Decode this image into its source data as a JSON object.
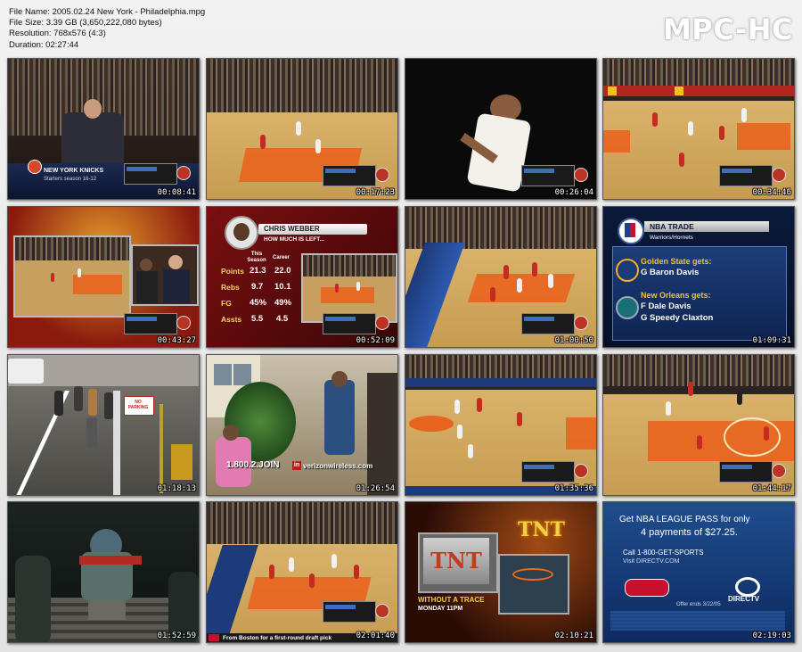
{
  "file_info": {
    "name": "File Name: 2005.02.24 New York - Philadelphia.mpg",
    "size": "File Size: 3.39 GB (3,650,222,080 bytes)",
    "resolution": "Resolution: 768x576 (4:3)",
    "duration": "Duration: 02:27:44"
  },
  "brand": "MPC-HC",
  "thumbnails": [
    {
      "time": "00:08:41",
      "caption": "NEW YORK KNICKS",
      "sub": "Starters season 16-12"
    },
    {
      "time": "00:17:23"
    },
    {
      "time": "00:26:04"
    },
    {
      "time": "00:34:46"
    },
    {
      "time": "00:43:27"
    },
    {
      "time": "00:52:09",
      "title": "CHRIS WEBBER",
      "subtitle": "HOW MUCH IS LEFT...",
      "cols": [
        "This Season",
        "Career"
      ],
      "rows": [
        [
          "Points",
          "21.3",
          "22.0"
        ],
        [
          "Rebs",
          "9.7",
          "10.1"
        ],
        [
          "FG",
          "45%",
          "49%"
        ],
        [
          "Assts",
          "5.5",
          "4.5"
        ]
      ]
    },
    {
      "time": "01:00:50"
    },
    {
      "time": "01:09:31",
      "title": "NBA TRADE",
      "subtitle": "Warriors/Hornets",
      "gs": "Golden State gets:",
      "gs1": "G  Baron Davis",
      "no": "New Orleans gets:",
      "no1": "F  Dale Davis",
      "no2": "G  Speedy Claxton"
    },
    {
      "time": "01:18:13",
      "sign": "NO PARKING"
    },
    {
      "time": "01:26:54",
      "ad": "1.800.2.JOIN",
      "ad2": "verizonwireless.com"
    },
    {
      "time": "01:35:36"
    },
    {
      "time": "01:44:17"
    },
    {
      "time": "01:52:59"
    },
    {
      "time": "02:01:40",
      "ticker": "From Boston for a first-round draft pick"
    },
    {
      "time": "02:10:21",
      "logo": "TNT",
      "show": "WITHOUT A TRACE",
      "when": "MONDAY 11PM"
    },
    {
      "time": "02:19:03",
      "l1": "Get NBA LEAGUE PASS for only",
      "l2": "4 payments of $27.25.",
      "l3": "Call 1-800-GET-SPORTS",
      "l4": "Visit DIRECTV.COM",
      "l5": "Offer ends 3/22/05",
      "dtv": "DIRECTV"
    }
  ]
}
